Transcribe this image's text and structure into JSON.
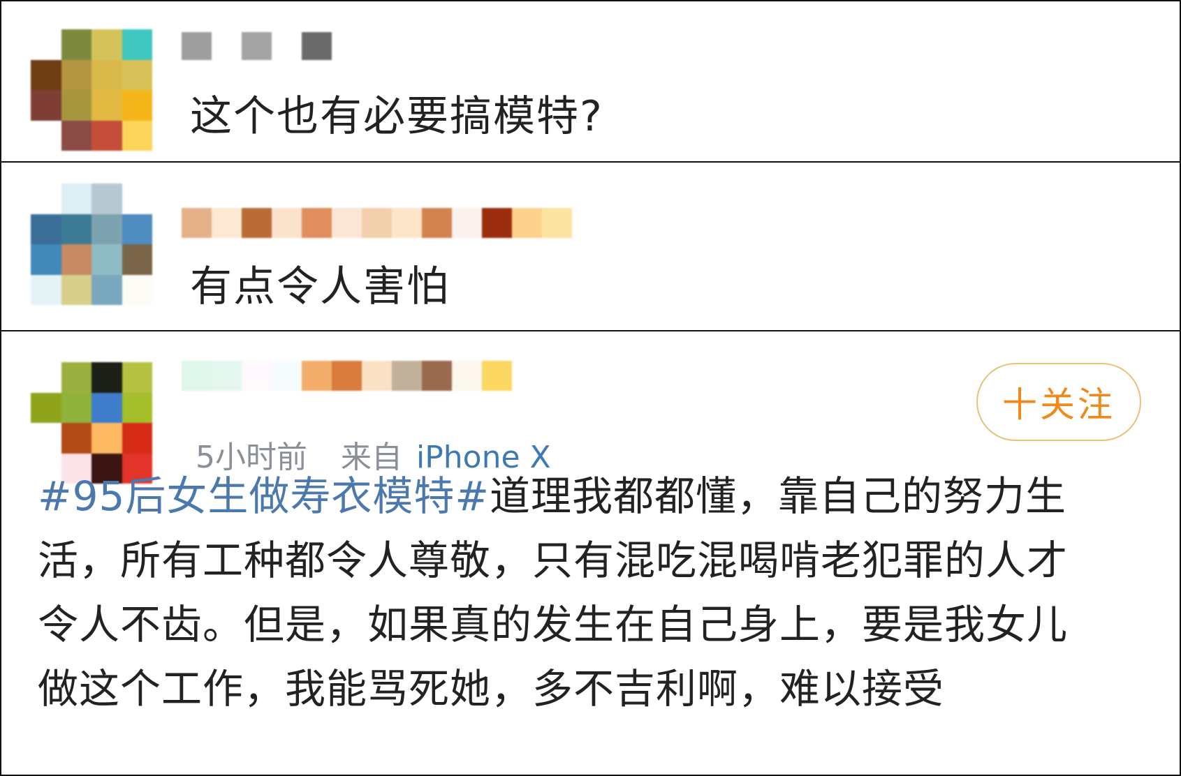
{
  "comments": [
    {
      "avatar_colors": [
        "#ffffff",
        "#7d8a3e",
        "#d4c35a",
        "#3fc7c0",
        "#6e3d12",
        "#b49541",
        "#d9b94a",
        "#d9c15a",
        "#7f3e34",
        "#a8963e",
        "#e2b941",
        "#f4b619",
        "#ffffff",
        "#8a4c45",
        "#c44e3a",
        "#fbd55a"
      ],
      "name_colors": [
        "#9e9e9e",
        "#a3a3a3",
        "#6a6a6a"
      ],
      "text": "这个也有必要搞模特?"
    },
    {
      "avatar_colors": [
        "#ffffff",
        "#ddeef4",
        "#b6c8d2",
        "#ffffff",
        "#3a6e99",
        "#3d7b94",
        "#7ea3b0",
        "#4f8dc1",
        "#3f88b8",
        "#c78a62",
        "#8fbcc4",
        "#7a6548",
        "#e5f3f7",
        "#d7cf8b",
        "#7aa8bf",
        "#fdfcf4"
      ],
      "name_colors": [
        "#e6b089",
        "#fbe9d3",
        "#b96c36",
        "#fae2cc",
        "#e08e5e",
        "#fbe6d6",
        "#f3d0ad",
        "#fde5c9",
        "#d3834f",
        "#fbf1ee",
        "#9b2d0f",
        "#fcd28c",
        "#fde3a2"
      ],
      "text": "有点令人害怕"
    },
    {
      "avatar_colors": [
        "#ffffff",
        "#9bb040",
        "#1c1f17",
        "#b3c240",
        "#8fa41b",
        "#8fb33a",
        "#3e7dca",
        "#a5bf2a",
        "#ffffff",
        "#b24b16",
        "#fdb961",
        "#d62b17",
        "#ffffff",
        "#fbe3e8",
        "#3b1512",
        "#e2342a"
      ],
      "name_colors": [
        "#dff6ea",
        "#e3f7ee",
        "#fff8fc",
        "#f6fbfe",
        "#f4ae6c",
        "#d97c3c",
        "#fbe1c4",
        "#c1b19a",
        "#9a6a4e",
        "#fdf8ee",
        "#fcd862"
      ],
      "time": "5小时前",
      "source_label": "来自",
      "device": "iPhone X",
      "follow_label": "十关注",
      "hashtag": "#95后女生做寿衣模特#",
      "body_line1": "道理我都都懂，靠自己的努力生",
      "body_line2": "活，所有工种都令人尊敬，只有混吃混喝啃老犯罪的人才",
      "body_line3": "令人不齿。但是，如果真的发生在自己身上，要是我女儿",
      "body_line4": "做这个工作，我能骂死她，多不吉利啊，难以接受"
    }
  ]
}
